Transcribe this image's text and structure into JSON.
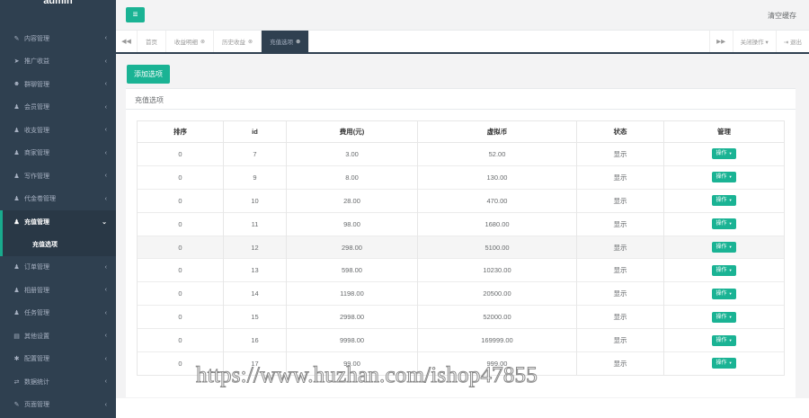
{
  "sidebar": {
    "brand": "admin",
    "items": [
      {
        "icon": "edit-icon",
        "glyph": "✎",
        "label": "内容管理"
      },
      {
        "icon": "send-icon",
        "glyph": "➤",
        "label": "推广收益"
      },
      {
        "icon": "users-icon",
        "glyph": "☻",
        "label": "群聊管理"
      },
      {
        "icon": "user-icon",
        "glyph": "♟",
        "label": "会员管理"
      },
      {
        "icon": "user-icon",
        "glyph": "♟",
        "label": "收支管理"
      },
      {
        "icon": "user-icon",
        "glyph": "♟",
        "label": "商家管理"
      },
      {
        "icon": "user-icon",
        "glyph": "♟",
        "label": "写作管理"
      },
      {
        "icon": "user-icon",
        "glyph": "♟",
        "label": "代金卷管理"
      },
      {
        "icon": "user-icon",
        "glyph": "♟",
        "label": "充值管理",
        "active": true
      },
      {
        "icon": "user-icon",
        "glyph": "♟",
        "label": "订单管理"
      },
      {
        "icon": "user-icon",
        "glyph": "♟",
        "label": "相册管理"
      },
      {
        "icon": "user-icon",
        "glyph": "♟",
        "label": "任务管理"
      },
      {
        "icon": "book-icon",
        "glyph": "▤",
        "label": "其他设置"
      },
      {
        "icon": "gear-icon",
        "glyph": "✱",
        "label": "配置管理"
      },
      {
        "icon": "exchange-icon",
        "glyph": "⇄",
        "label": "数据统计"
      },
      {
        "icon": "edit-icon",
        "glyph": "✎",
        "label": "页面管理"
      }
    ],
    "active_sub": "充值选项"
  },
  "topbar": {
    "menu_glyph": "≡",
    "clear_cache": "清空缓存"
  },
  "tabs": {
    "back_glyph": "◀◀",
    "items": [
      {
        "label": "首页",
        "closable": false
      },
      {
        "label": "收益明细",
        "closable": true
      },
      {
        "label": "历史收益",
        "closable": true
      },
      {
        "label": "充值选项",
        "closable": true,
        "active": true
      }
    ],
    "forward_glyph": "▶▶",
    "close_ops": "关闭操作 ▾",
    "logout": "⇥ 退出"
  },
  "main": {
    "add_button": "添加选项",
    "panel_title": "充值选项",
    "columns": [
      "排序",
      "id",
      "费用(元)",
      "虚拟币",
      "状态",
      "管理"
    ],
    "rows": [
      {
        "sort": "0",
        "id": "7",
        "fee": "3.00",
        "coins": "52.00",
        "status": "显示"
      },
      {
        "sort": "0",
        "id": "9",
        "fee": "8.00",
        "coins": "130.00",
        "status": "显示"
      },
      {
        "sort": "0",
        "id": "10",
        "fee": "28.00",
        "coins": "470.00",
        "status": "显示"
      },
      {
        "sort": "0",
        "id": "11",
        "fee": "98.00",
        "coins": "1680.00",
        "status": "显示"
      },
      {
        "sort": "0",
        "id": "12",
        "fee": "298.00",
        "coins": "5100.00",
        "status": "显示"
      },
      {
        "sort": "0",
        "id": "13",
        "fee": "598.00",
        "coins": "10230.00",
        "status": "显示"
      },
      {
        "sort": "0",
        "id": "14",
        "fee": "1198.00",
        "coins": "20500.00",
        "status": "显示"
      },
      {
        "sort": "0",
        "id": "15",
        "fee": "2998.00",
        "coins": "52000.00",
        "status": "显示"
      },
      {
        "sort": "0",
        "id": "16",
        "fee": "9998.00",
        "coins": "169999.00",
        "status": "显示"
      },
      {
        "sort": "0",
        "id": "17",
        "fee": "99.00",
        "coins": "999.00",
        "status": "显示"
      }
    ],
    "op_label": "操作",
    "highlighted_row_index": 4
  },
  "watermark": "https://www.huzhan.com/ishop47855",
  "colors": {
    "sidebar_bg": "#2f4050",
    "accent": "#1ab394"
  }
}
